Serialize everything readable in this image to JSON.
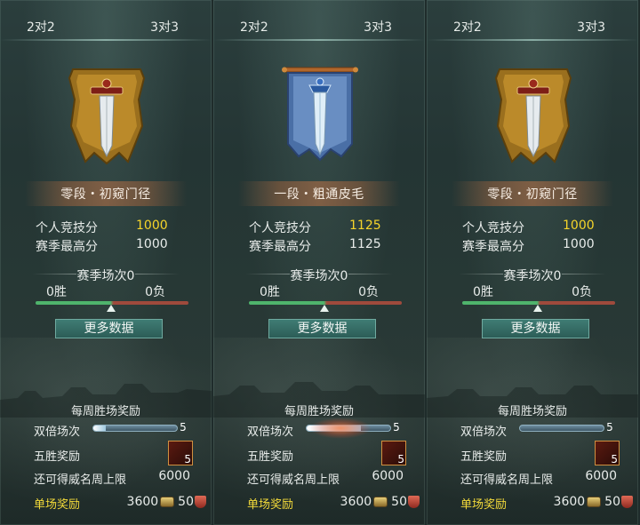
{
  "panels": [
    {
      "tab_2v2": "2对2",
      "tab_3v3": "3对3",
      "emblem_icon": "gold-sword-banner-icon",
      "rank_title": "零段・初窥门径",
      "personal_score_label": "个人竞技分",
      "personal_score_value": "1000",
      "season_high_label": "赛季最高分",
      "season_high_value": "1000",
      "season_matches": "赛季场次0",
      "wins": "0胜",
      "losses": "0负",
      "more_button": "更多数据",
      "weekly_title": "每周胜场奖励",
      "double_label": "双倍场次",
      "double_count": "5",
      "double_fill": 0.15,
      "five_win_label": "五胜奖励",
      "five_win_count": "5",
      "limit_label": "还可得威名周上限",
      "limit_value": "6000",
      "single_label": "单场奖励",
      "single_coin": "3600",
      "single_shield": "50"
    },
    {
      "tab_2v2": "2对2",
      "tab_3v3": "3对3",
      "emblem_icon": "blue-sword-banner-icon",
      "rank_title": "一段・粗通皮毛",
      "personal_score_label": "个人竞技分",
      "personal_score_value": "1125",
      "season_high_label": "赛季最高分",
      "season_high_value": "1125",
      "season_matches": "赛季场次0",
      "wins": "0胜",
      "losses": "0负",
      "more_button": "更多数据",
      "weekly_title": "每周胜场奖励",
      "double_label": "双倍场次",
      "double_count": "5",
      "double_fill": 0.65,
      "five_win_label": "五胜奖励",
      "five_win_count": "5",
      "limit_label": "还可得威名周上限",
      "limit_value": "6000",
      "single_label": "单场奖励",
      "single_coin": "3600",
      "single_shield": "50"
    },
    {
      "tab_2v2": "2对2",
      "tab_3v3": "3对3",
      "emblem_icon": "gold-sword-banner-icon",
      "rank_title": "零段・初窥门径",
      "personal_score_label": "个人竞技分",
      "personal_score_value": "1000",
      "season_high_label": "赛季最高分",
      "season_high_value": "1000",
      "season_matches": "赛季场次0",
      "wins": "0胜",
      "losses": "0负",
      "more_button": "更多数据",
      "weekly_title": "每周胜场奖励",
      "double_label": "双倍场次",
      "double_count": "5",
      "double_fill": 0.0,
      "five_win_label": "五胜奖励",
      "five_win_count": "5",
      "limit_label": "还可得威名周上限",
      "limit_value": "6000",
      "single_label": "单场奖励",
      "single_coin": "3600",
      "single_shield": "50"
    }
  ],
  "colors": {
    "score_gold": "#f6d52a",
    "reward_yellow": "#f3da3a",
    "win_green": "#4fb46c",
    "loss_red": "#9f4a3c"
  }
}
